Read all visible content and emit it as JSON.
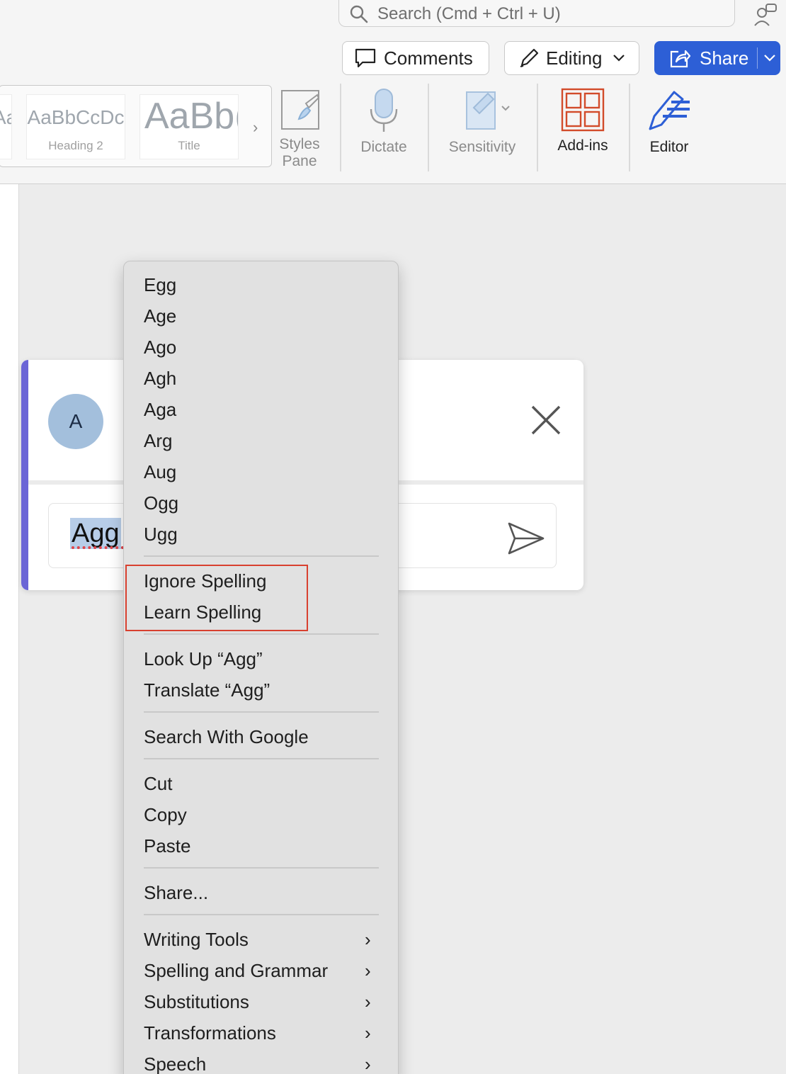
{
  "search": {
    "placeholder": "Search (Cmd + Ctrl + U)"
  },
  "toolbar": {
    "comments_label": "Comments",
    "editing_label": "Editing",
    "share_label": "Share"
  },
  "styles_gallery": {
    "tiles": [
      {
        "preview": "AaBbCcDc",
        "name": ""
      },
      {
        "preview": "AaBbCcDc",
        "name": "Heading 2"
      },
      {
        "preview": "AaBb(",
        "name": "Title"
      }
    ]
  },
  "ribbon": {
    "styles_pane": [
      "Styles",
      "Pane"
    ],
    "dictate": "Dictate",
    "sensitivity": "Sensitivity",
    "addins": "Add-ins",
    "editor": "Editor"
  },
  "comment": {
    "avatar_initial": "A",
    "reply_text": "Agg"
  },
  "context_menu": {
    "suggestions": [
      "Egg",
      "Age",
      "Ago",
      "Agh",
      "Aga",
      "Arg",
      "Aug",
      "Ogg",
      "Ugg"
    ],
    "spelling": [
      "Ignore Spelling",
      "Learn Spelling"
    ],
    "lookup": [
      "Look Up “Agg”",
      "Translate “Agg”"
    ],
    "search": [
      "Search With Google"
    ],
    "edit": [
      "Cut",
      "Copy",
      "Paste"
    ],
    "share": [
      "Share..."
    ],
    "submenus": [
      "Writing Tools",
      "Spelling and Grammar",
      "Substitutions",
      "Transformations",
      "Speech"
    ]
  },
  "colors": {
    "share_button": "#2d5fd6",
    "comment_accent": "#6b65d6",
    "highlight_box": "#d8402f",
    "addins_icon": "#d24b2a",
    "editor_icon": "#2d5fd6",
    "spelling_squiggle": "#e0454a"
  },
  "icons": {
    "search": "magnifier-icon",
    "person": "share-people-icon",
    "comments": "speech-bubble-icon",
    "editing": "pencil-icon",
    "share": "share-arrow-icon",
    "styles_pane": "brush-icon",
    "dictate": "microphone-icon",
    "sensitivity": "tag-icon",
    "addins": "grid-icon",
    "editor": "editor-pen-icon",
    "close": "close-icon",
    "send": "send-icon"
  }
}
